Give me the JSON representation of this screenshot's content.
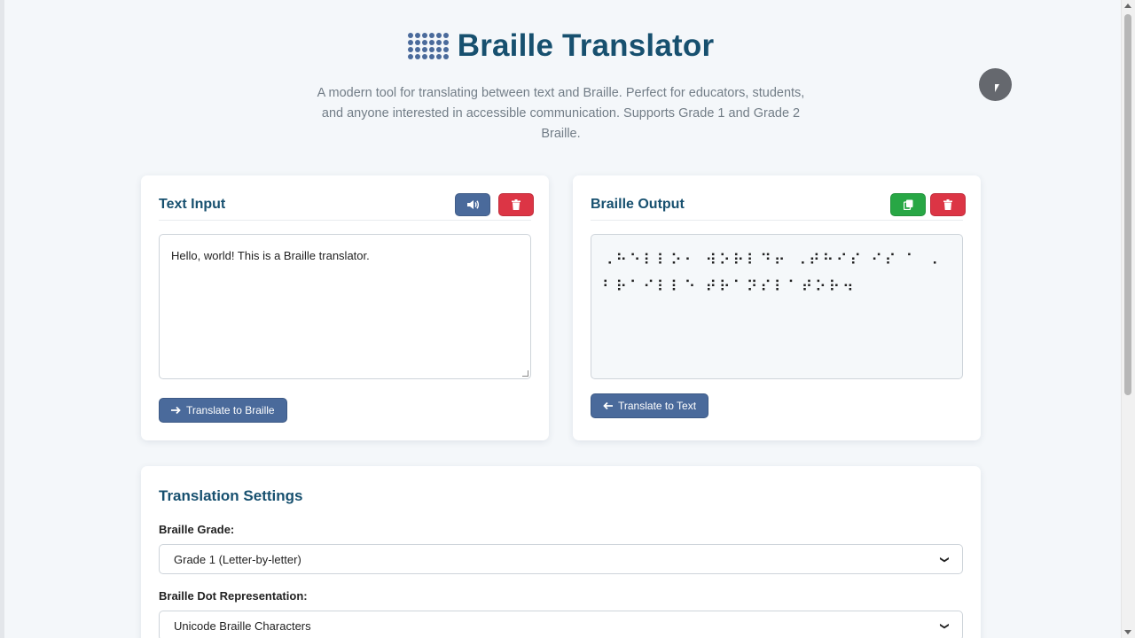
{
  "app": {
    "title": "Braille Translator",
    "subtitle": "A modern tool for translating between text and Braille. Perfect for educators, students, and anyone interested in accessible communication. Supports Grade 1 and Grade 2 Braille."
  },
  "text_input_card": {
    "title": "Text Input",
    "speak_icon": "speaker-icon",
    "clear_icon": "trash-icon",
    "text_value": "Hello, world! This is a Braille translator.",
    "translate_button": "Translate to Braille",
    "translate_icon": "arrow-right-icon"
  },
  "braille_output_card": {
    "title": "Braille Output",
    "copy_icon": "copy-icon",
    "clear_icon": "trash-icon",
    "braille_value": "⠠⠓⠑⠇⠇⠕⠂ ⠺⠕⠗⠇⠙⠖ ⠠⠞⠓⠊⠎ ⠊⠎ ⠁ ⠠⠃⠗⠁⠊⠇⠇⠑ ⠞⠗⠁⠝⠎⠇⠁⠞⠕⠗⠲",
    "translate_button": "Translate to Text",
    "translate_icon": "arrow-left-icon"
  },
  "settings": {
    "title": "Translation Settings",
    "grade_label": "Braille Grade:",
    "grade_selected": "Grade 1 (Letter-by-letter)",
    "dot_label": "Braille Dot Representation:",
    "dot_selected": "Unicode Braille Characters"
  },
  "colors": {
    "primary": "#4a6a9b",
    "danger": "#dc3545",
    "success": "#28a745",
    "heading": "#17506f"
  }
}
